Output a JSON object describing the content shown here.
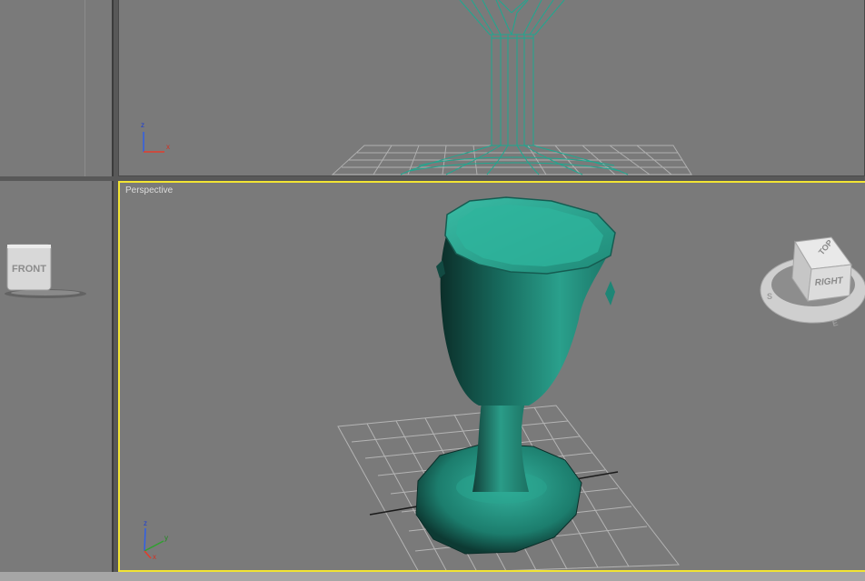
{
  "viewports": {
    "top_left": {
      "label": ""
    },
    "top_right": {
      "label": ""
    },
    "bottom_left": {
      "label": "",
      "viewcube": {
        "face": "FRONT"
      }
    },
    "perspective": {
      "label": "Perspective",
      "viewcube": {
        "top": "TOP",
        "right": "RIGHT",
        "compass_letters": [
          "S",
          "E"
        ]
      }
    }
  },
  "axis_gizmo": {
    "front": {
      "z": "z",
      "x": "x"
    },
    "perspective": {
      "z": "z",
      "y": "y",
      "x": "x"
    }
  },
  "colors": {
    "active_border": "#f2e433",
    "viewport_bg": "#7a7a7a",
    "object": "#2a9c88",
    "wireframe": "#2bb39c",
    "grid": "#b8b8b8"
  }
}
